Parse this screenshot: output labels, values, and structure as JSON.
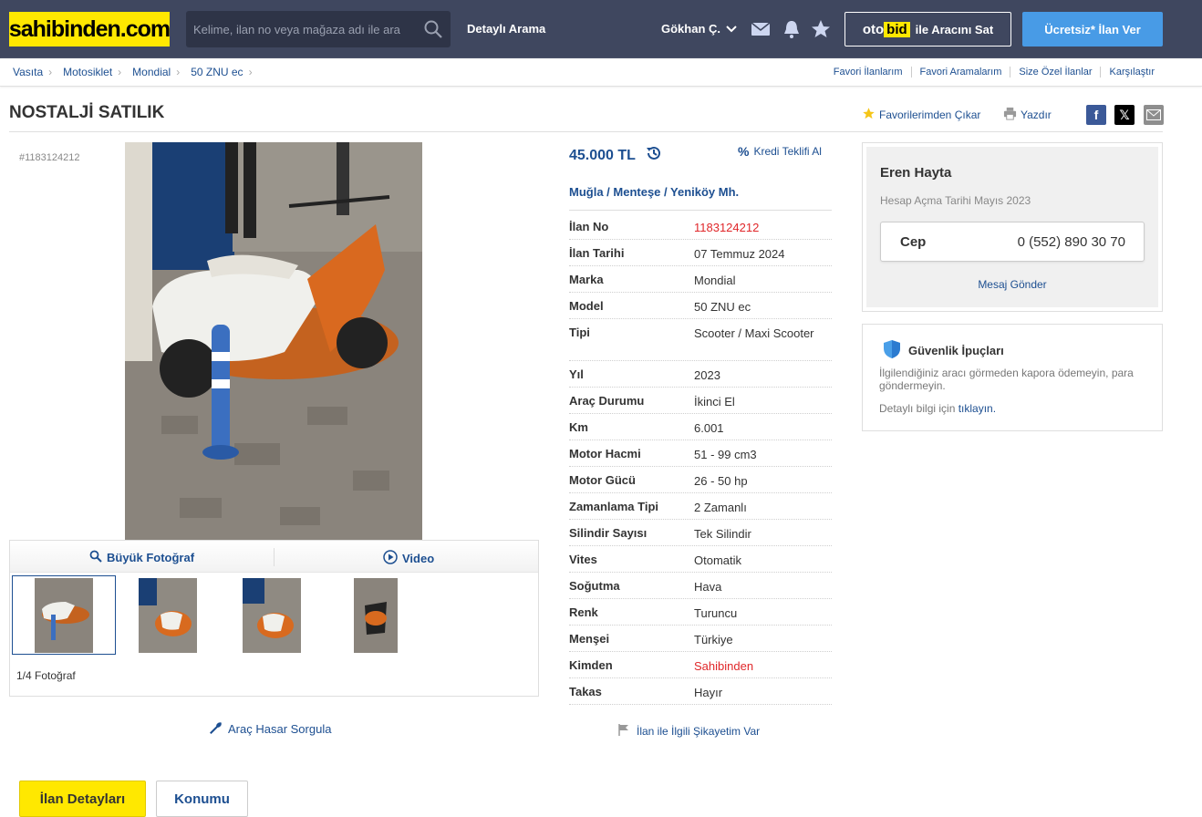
{
  "header": {
    "logo": "sahibinden.com",
    "search_placeholder": "Kelime, ilan no veya mağaza adı ile ara",
    "advanced_search": "Detaylı Arama",
    "user_name": "Gökhan Ç.",
    "otobid_oto": "oto",
    "otobid_bid": "bid",
    "otobid_suffix": "ile Aracını Sat",
    "post_ad": "Ücretsiz* İlan Ver",
    "colors": {
      "bg": "#3f475f",
      "logo": "#ffe800",
      "post_ad": "#489be6"
    }
  },
  "breadcrumb": [
    "Vasıta",
    "Motosiklet",
    "Mondial",
    "50 ZNU ec"
  ],
  "toplinks": [
    "Favori İlanlarım",
    "Favori Aramalarım",
    "Size Özel İlanlar",
    "Karşılaştır"
  ],
  "listing": {
    "title": "NOSTALJİ SATILIK",
    "fav_remove": "Favorilerimden Çıkar",
    "print": "Yazdır",
    "id_small": "#1183124212",
    "price": "45.000 TL",
    "credit": "Kredi Teklifi Al",
    "location": "Muğla  /  Menteşe  /  Yeniköy Mh.",
    "photo_count": "1/4 Fotoğraf",
    "big_photo": "Büyük Fotoğraf",
    "video": "Video",
    "damage_query": "Araç Hasar Sorgula",
    "complaint": "İlan ile İlgili Şikayetim Var"
  },
  "details": [
    {
      "k": "İlan No",
      "v": "1183124212",
      "red": true
    },
    {
      "k": "İlan Tarihi",
      "v": "07 Temmuz 2024"
    },
    {
      "k": "Marka",
      "v": "Mondial"
    },
    {
      "k": "Model",
      "v": "50 ZNU ec"
    },
    {
      "k": "Tipi",
      "v": "Scooter / Maxi Scooter",
      "tall": true
    },
    {
      "k": "Yıl",
      "v": "2023"
    },
    {
      "k": "Araç Durumu",
      "v": "İkinci El"
    },
    {
      "k": "Km",
      "v": "6.001"
    },
    {
      "k": "Motor Hacmi",
      "v": "51 - 99 cm3"
    },
    {
      "k": "Motor Gücü",
      "v": "26 - 50 hp"
    },
    {
      "k": "Zamanlama Tipi",
      "v": "2 Zamanlı"
    },
    {
      "k": "Silindir Sayısı",
      "v": "Tek Silindir"
    },
    {
      "k": "Vites",
      "v": "Otomatik"
    },
    {
      "k": "Soğutma",
      "v": "Hava"
    },
    {
      "k": "Renk",
      "v": "Turuncu"
    },
    {
      "k": "Menşei",
      "v": "Türkiye"
    },
    {
      "k": "Kimden",
      "v": "Sahibinden",
      "red": true
    },
    {
      "k": "Takas",
      "v": "Hayır"
    }
  ],
  "seller": {
    "name": "Eren Hayta",
    "since": "Hesap Açma Tarihi  Mayıs 2023",
    "phone_label": "Cep",
    "phone": "0 (552) 890 30 70",
    "message": "Mesaj Gönder"
  },
  "safety": {
    "title": "Güvenlik İpuçları",
    "text": "İlgilendiğiniz aracı görmeden kapora ödemeyin, para göndermeyin.",
    "more_prefix": "Detaylı bilgi için",
    "more_link": "tıklayın."
  },
  "bottom_tabs": [
    "İlan Detayları",
    "Konumu"
  ]
}
